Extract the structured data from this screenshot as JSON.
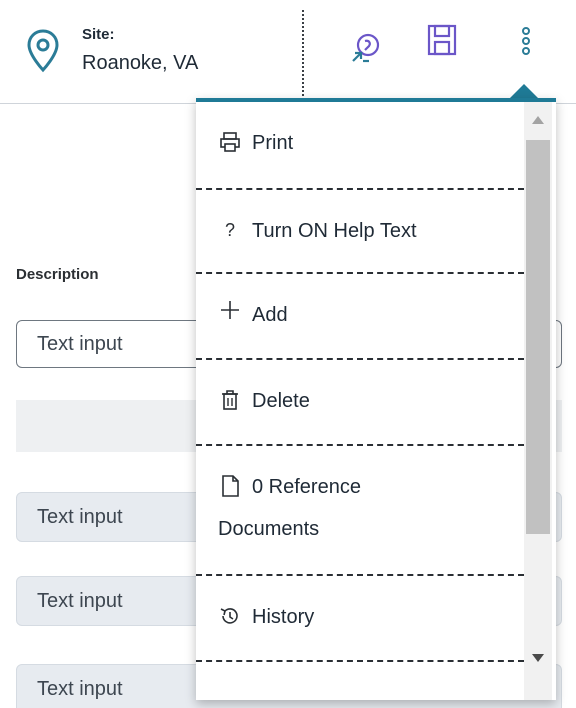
{
  "header": {
    "site_label": "Site:",
    "site_value": "Roanoke, VA",
    "icons": {
      "location": "map-pin-icon",
      "sync": "sync-icon",
      "save": "save-icon",
      "more": "more-vertical-icon"
    }
  },
  "form": {
    "description_label": "Description",
    "fields": [
      {
        "placeholder": "Text input"
      },
      {
        "placeholder": "Text input"
      },
      {
        "placeholder": "Text input"
      },
      {
        "placeholder": "Text input"
      }
    ]
  },
  "menu": {
    "items": [
      {
        "label": "Print",
        "icon": "print-icon"
      },
      {
        "label": "Turn ON Help Text",
        "icon": "help-icon"
      },
      {
        "label": "Add",
        "icon": "plus-icon"
      },
      {
        "label": "Delete",
        "icon": "trash-icon"
      },
      {
        "label_line1": "0 Reference",
        "label_line2": "Documents",
        "icon": "document-icon"
      },
      {
        "label": "History",
        "icon": "history-icon"
      }
    ]
  },
  "colors": {
    "accent": "#1f7a96",
    "icon_purple": "#6b56c8",
    "icon_teal": "#2b7c97"
  }
}
